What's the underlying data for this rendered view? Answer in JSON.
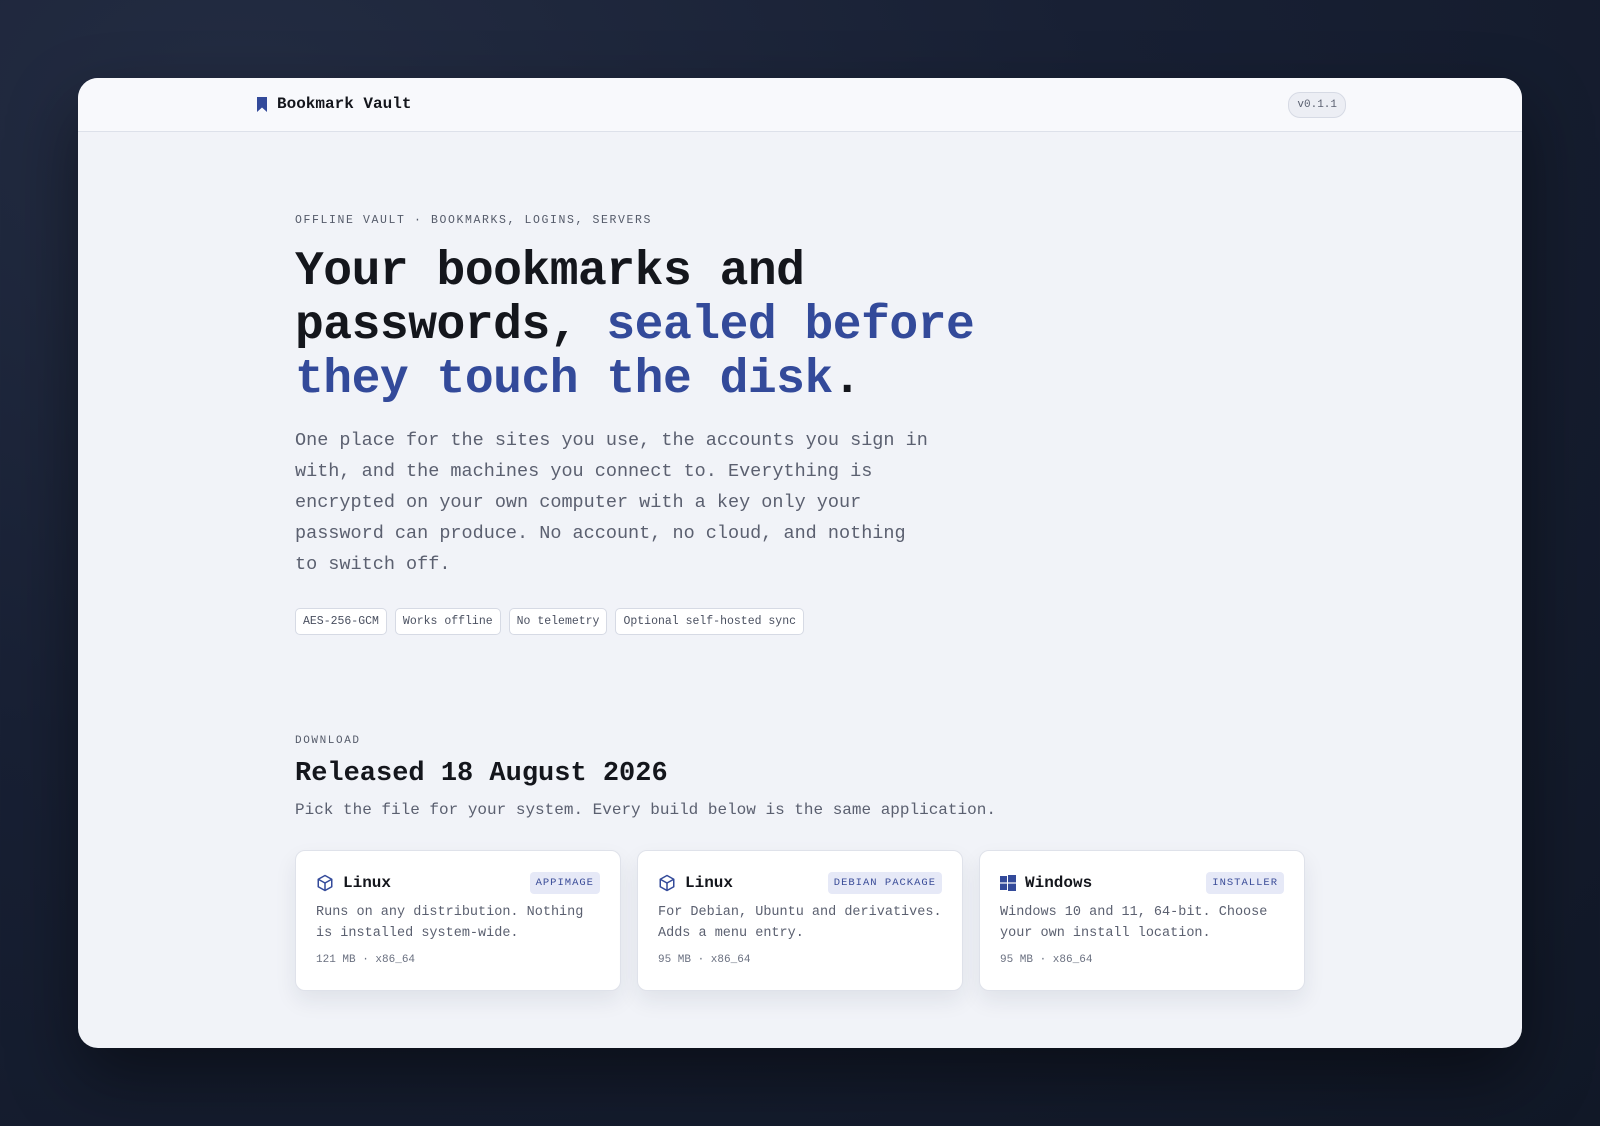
{
  "header": {
    "brand": "Bookmark Vault",
    "brand_icon": "bookmark-icon",
    "version": "v0.1.1"
  },
  "hero": {
    "eyebrow": "OFFLINE VAULT · BOOKMARKS, LOGINS, SERVERS",
    "title_plain": "Your bookmarks and passwords, ",
    "title_accent": "sealed before they touch the disk",
    "title_end": ".",
    "lead": "One place for the sites you use, the accounts you sign in with, and the machines you connect to. Everything is encrypted on your own computer with a key only your password can produce. No account, no cloud, and nothing to switch off.",
    "tags": [
      "AES-256-GCM",
      "Works offline",
      "No telemetry",
      "Optional self-hosted sync"
    ]
  },
  "download": {
    "eyebrow": "DOWNLOAD",
    "title": "Released 18 August 2026",
    "subtitle": "Pick the file for your system. Every build below is the same application.",
    "builds": [
      {
        "os": "Linux",
        "icon": "package-icon",
        "badge": "APPIMAGE",
        "description": "Runs on any distribution. Nothing is installed system-wide.",
        "meta": "121 MB · x86_64"
      },
      {
        "os": "Linux",
        "icon": "package-icon",
        "badge": "DEBIAN PACKAGE",
        "description": "For Debian, Ubuntu and derivatives. Adds a menu entry.",
        "meta": "95 MB · x86_64"
      },
      {
        "os": "Windows",
        "icon": "windows-icon",
        "badge": "INSTALLER",
        "description": "Windows 10 and 11, 64-bit. Choose your own install location.",
        "meta": "95 MB · x86_64"
      }
    ]
  },
  "colors": {
    "accent": "#334a9a",
    "page_background": "#f1f3f8",
    "outer_background": "#161e30"
  }
}
